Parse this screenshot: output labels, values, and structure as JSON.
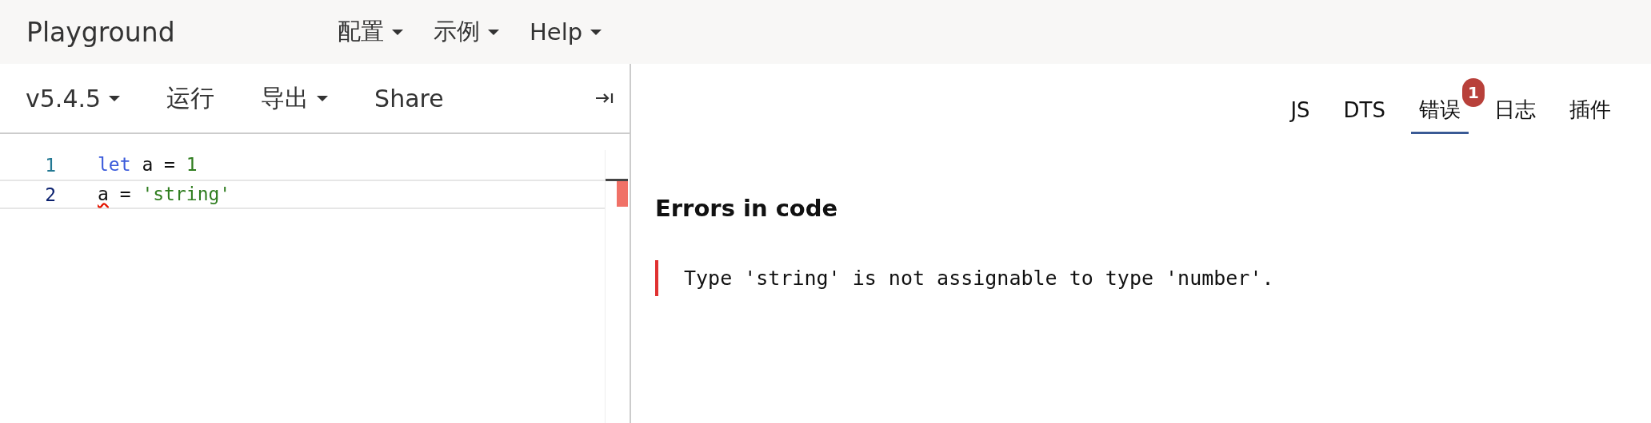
{
  "header": {
    "title": "Playground",
    "menus": [
      {
        "label": "配置"
      },
      {
        "label": "示例"
      },
      {
        "label": "Help"
      }
    ]
  },
  "toolbar": {
    "items": [
      {
        "label": "v5.4.5",
        "kind": "dropdown"
      },
      {
        "label": "运行",
        "kind": "button"
      },
      {
        "label": "导出",
        "kind": "dropdown"
      },
      {
        "label": "Share",
        "kind": "button"
      }
    ]
  },
  "editor": {
    "lines": [
      {
        "number": "1",
        "current": false,
        "tokens": [
          {
            "text": "let",
            "kind": "keyword",
            "error": false
          },
          {
            "text": " a = ",
            "kind": "plain",
            "error": false
          },
          {
            "text": "1",
            "kind": "number",
            "error": false
          }
        ]
      },
      {
        "number": "2",
        "current": true,
        "tokens": [
          {
            "text": "a",
            "kind": "plain",
            "error": true
          },
          {
            "text": " = ",
            "kind": "plain",
            "error": false
          },
          {
            "text": "'string'",
            "kind": "string",
            "error": false
          }
        ]
      }
    ]
  },
  "tabs": [
    {
      "label": "JS",
      "selected": false
    },
    {
      "label": "DTS",
      "selected": false
    },
    {
      "label": "错误",
      "selected": true,
      "badge": "1"
    },
    {
      "label": "日志",
      "selected": false
    },
    {
      "label": "插件",
      "selected": false
    }
  ],
  "errors": {
    "heading": "Errors in code",
    "messages": [
      "Type 'string' is not assignable to type 'number'."
    ]
  }
}
